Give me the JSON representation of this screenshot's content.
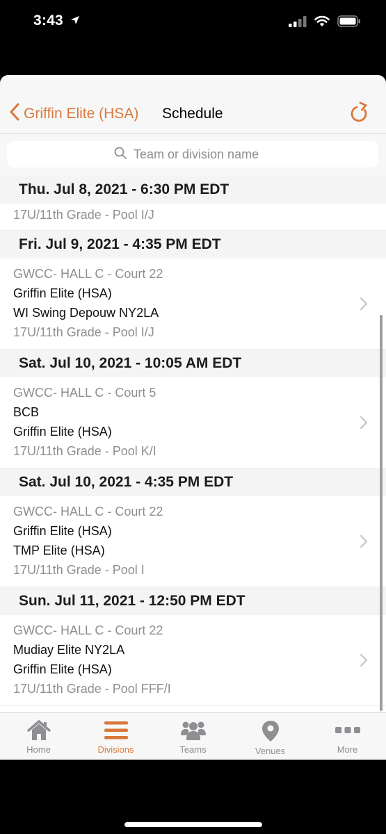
{
  "status": {
    "time": "3:43"
  },
  "nav": {
    "back_label": "Griffin Elite (HSA)",
    "title": "Schedule"
  },
  "search": {
    "placeholder": "Team or division name"
  },
  "sections": [
    {
      "date": "Thu. Jul 8, 2021 - 6:30 PM EDT",
      "games": [
        {
          "court": "",
          "team1": "",
          "team2": "",
          "division": "17U/11th Grade - Pool I/J"
        }
      ]
    },
    {
      "date": "Fri. Jul 9, 2021 - 4:35 PM EDT",
      "games": [
        {
          "court": "GWCC- HALL C - Court 22",
          "team1": "Griffin Elite (HSA)",
          "team2": "WI Swing Depouw NY2LA",
          "division": "17U/11th Grade - Pool I/J"
        }
      ]
    },
    {
      "date": "Sat. Jul 10, 2021 - 10:05 AM EDT",
      "games": [
        {
          "court": "GWCC- HALL C - Court 5",
          "team1": "BCB",
          "team2": "Griffin Elite (HSA)",
          "division": "17U/11th Grade - Pool K/I"
        }
      ]
    },
    {
      "date": "Sat. Jul 10, 2021 - 4:35 PM EDT",
      "games": [
        {
          "court": "GWCC- HALL C - Court 22",
          "team1": "Griffin Elite (HSA)",
          "team2": "TMP Elite (HSA)",
          "division": "17U/11th Grade - Pool I"
        }
      ]
    },
    {
      "date": "Sun. Jul 11, 2021 - 12:50 PM EDT",
      "games": [
        {
          "court": "GWCC- HALL C - Court 22",
          "team1": "Mudiay Elite NY2LA",
          "team2": "Griffin Elite (HSA)",
          "division": "17U/11th Grade - Pool FFF/I"
        }
      ]
    }
  ],
  "tabs": [
    {
      "label": "Home",
      "icon": "home-icon",
      "active": false
    },
    {
      "label": "Divisions",
      "icon": "menu-icon",
      "active": true
    },
    {
      "label": "Teams",
      "icon": "users-icon",
      "active": false
    },
    {
      "label": "Venues",
      "icon": "location-pin-icon",
      "active": false
    },
    {
      "label": "More",
      "icon": "more-dots-icon",
      "active": false
    }
  ],
  "colors": {
    "accent": "#d9773a",
    "inactive": "#8e8e93",
    "header_bg": "#f4f4f4"
  }
}
